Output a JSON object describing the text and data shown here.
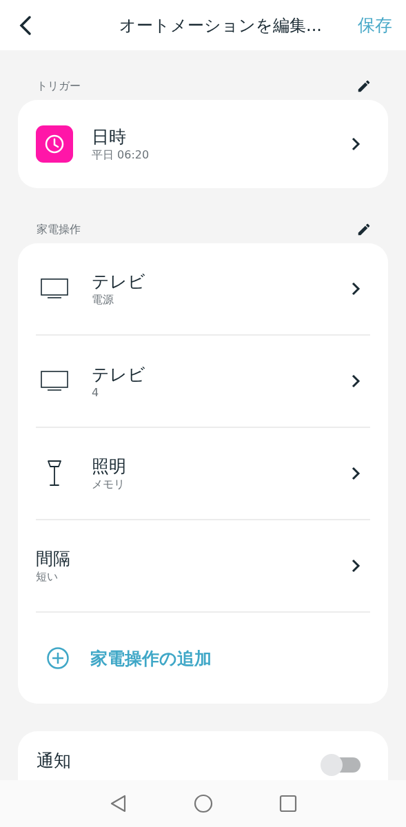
{
  "header": {
    "title": "オートメーションを編集...",
    "save": "保存"
  },
  "trigger": {
    "label": "トリガー",
    "item": {
      "title": "日時",
      "subtitle": "平日 06:20"
    }
  },
  "actions": {
    "label": "家電操作",
    "items": [
      {
        "kind": "tv",
        "title": "テレビ",
        "subtitle": "電源"
      },
      {
        "kind": "tv",
        "title": "テレビ",
        "subtitle": "4"
      },
      {
        "kind": "lamp",
        "title": "照明",
        "subtitle": "メモリ"
      },
      {
        "kind": "interval",
        "title": "間隔",
        "subtitle": "短い"
      }
    ],
    "add": "家電操作の追加"
  },
  "notification": {
    "label": "通知",
    "on": false
  }
}
